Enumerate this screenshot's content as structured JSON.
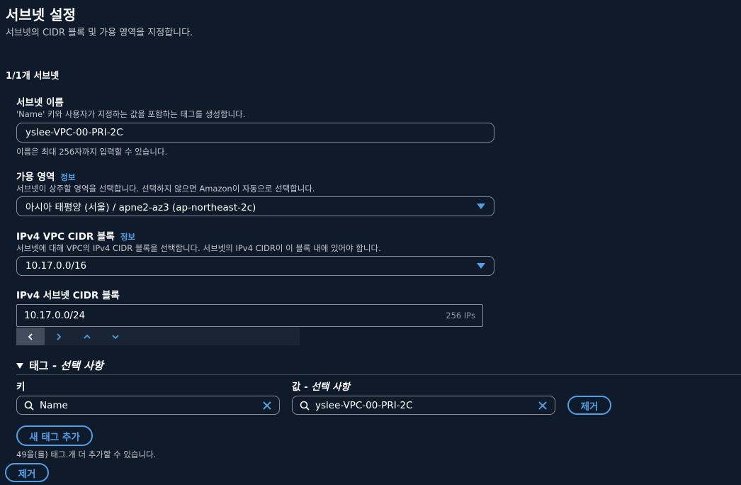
{
  "header": {
    "title": "서브넷 설정",
    "subtitle": "서브넷의 CIDR 블록 및 가용 영역을 지정합니다."
  },
  "subnet_count": "1/1개 서브넷",
  "subnet_name": {
    "label": "서브넷 이름",
    "description": "'Name' 키와 사용자가 지정하는 값을 포함하는 태그를 생성합니다.",
    "value": "yslee-VPC-00-PRI-2C",
    "hint": "이름은 최대 256자까지 입력할 수 있습니다."
  },
  "availability_zone": {
    "label": "가용 영역",
    "info": "정보",
    "description": "서브넷이 상주할 영역을 선택합니다. 선택하지 않으면 Amazon이 자동으로 선택합니다.",
    "selected": "아시아 태평양 (서울) / apne2-az3 (ap-northeast-2c)"
  },
  "vpc_cidr": {
    "label": "IPv4 VPC CIDR 블록",
    "info": "정보",
    "description": "서브넷에 대해 VPC의 IPv4 CIDR 블록을 선택합니다. 서브넷의 IPv4 CIDR이 이 블록 내에 있어야 합니다.",
    "selected": "10.17.0.0/16"
  },
  "subnet_cidr": {
    "label": "IPv4 서브넷 CIDR 블록",
    "value": "10.17.0.0/24",
    "ips": "256 IPs"
  },
  "tags": {
    "header_main": "태그 - ",
    "header_optional": "선택 사항",
    "key_label": "키",
    "value_label_main": "값 - ",
    "value_label_optional": "선택 사항",
    "key_value": "Name",
    "value_value": "yslee-VPC-00-PRI-2C",
    "remove_label": "제거",
    "add_label": "새 태그 추가",
    "remaining": "49을(를) 태그.개 더 추가할 수 있습니다."
  },
  "remove_subnet_label": "제거",
  "colors": {
    "background": "#0f1b2a",
    "accent": "#539fe5",
    "border": "#8c8c94"
  }
}
